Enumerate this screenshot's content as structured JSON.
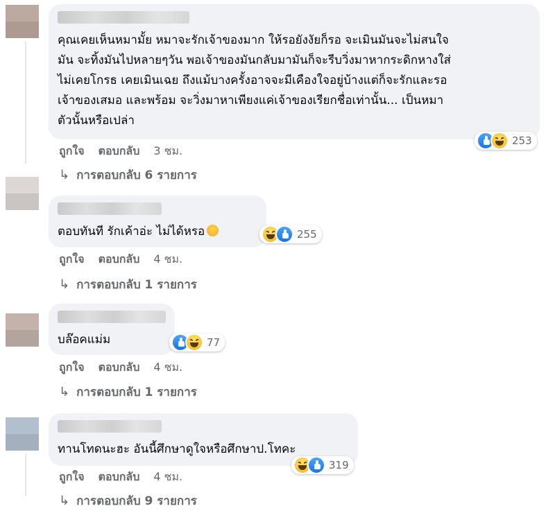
{
  "comments": [
    {
      "text": "คุณเคยเห็นหมามั้ย หมาจะรักเจ้าของมาก ให้รอยังงัยก็รอ จะเมินมันจะไม่สนใจ\nมัน จะทิ้งมันไปหลายๆวัน พอเจ้าของมันกลับมามันก็จะรีบวิ่งมาหากระดิกหางใส่\nไม่เคยโกรธ เคยเมินเฉย ถึงแม้บางครั้งอาจจะมีเคืองใจอยู่บ้างแต่ก็จะรักและรอ\nเจ้าของเสมอ และพร้อม จะวิ่งมาหาเพียงแค่เจ้าของเรียกชื่อเท่านั้น... เป็นหมา\nตัวนั้นหรือเปล่า",
      "reaction_count": "253",
      "like": "ถูกใจ",
      "reply": "ตอบกลับ",
      "time": "3 ชม.",
      "replies_label": "การตอบกลับ 6 รายการ"
    },
    {
      "text": "ตอบทันที รักเค้าอ่ะ ไม่ได้หรอ",
      "reaction_count": "255",
      "like": "ถูกใจ",
      "reply": "ตอบกลับ",
      "time": "4 ชม.",
      "replies_label": "การตอบกลับ 1 รายการ"
    },
    {
      "text": "บล๊อคแม่ม",
      "reaction_count": "77",
      "like": "ถูกใจ",
      "reply": "ตอบกลับ",
      "time": "4 ชม.",
      "replies_label": "การตอบกลับ 1 รายการ"
    },
    {
      "text": "ทานโทดนะฮะ อันนี้ศึกษาดูใจหรือศึกษาป.โทคะ",
      "reaction_count": "319",
      "like": "ถูกใจ",
      "reply": "ตอบกลับ",
      "time": "4 ชม.",
      "replies_label": "การตอบกลับ 9 รายการ"
    }
  ],
  "icons": {
    "like": "like-reaction-icon",
    "haha": "haha-reaction-icon",
    "reply_arrow": "reply-arrow-icon",
    "emoji": "smiling-emoji-icon"
  },
  "colors": {
    "bubble": "#f0f2f5",
    "meta_text": "#65676b",
    "like_blue": "#1b74e4",
    "haha_yellow": "#f7b125"
  }
}
